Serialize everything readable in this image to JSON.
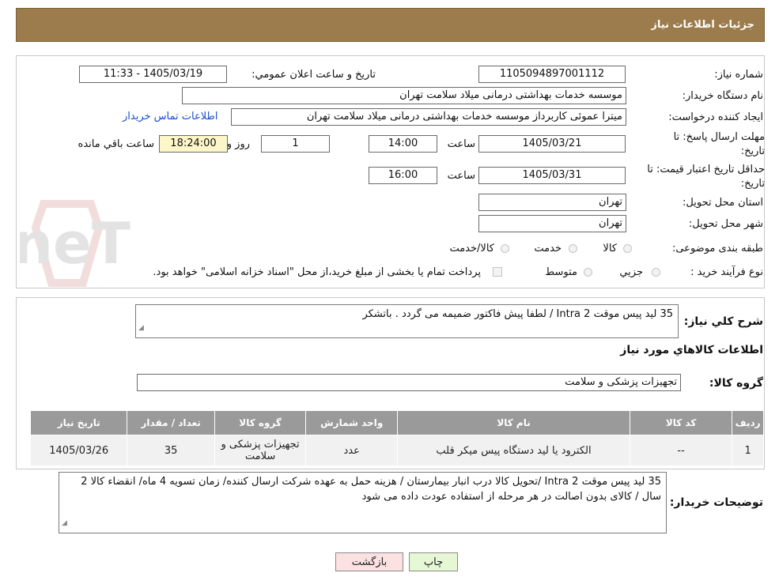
{
  "header": {
    "title": "جزئیات اطلاعات نیاز"
  },
  "watermark": {
    "text": "AriaTender.neT"
  },
  "form": {
    "need_number_label": "شماره نیاز:",
    "need_number": "1105094897001112",
    "announce_label": "تاریخ و ساعت اعلان عمومي:",
    "announce_value": "1405/03/19 - 11:33",
    "buyer_org_label": "نام دستگاه خريدار:",
    "buyer_org": "موسسه خدمات بهداشتی درمانی میلاد سلامت تهران",
    "creator_label": "ايجاد کننده درخواست:",
    "creator": "میترا عموئی کاربرداز موسسه خدمات بهداشتی درمانی میلاد سلامت تهران",
    "contact_link": "اطلاعات تماس خريدار",
    "deadline_label": "مهلت ارسال پاسخ: تا تاریخ:",
    "deadline_date": "1405/03/21",
    "time_label": "ساعت",
    "deadline_time": "14:00",
    "days_value": "1",
    "days_label": "روز و",
    "remaining_time": "18:24:00",
    "remaining_label": "ساعت باقي مانده",
    "validity_label": "حداقل تاریخ اعتبار قیمت: تا تاریخ:",
    "validity_date": "1405/03/31",
    "validity_time_label": "ساعت",
    "validity_time": "16:00",
    "province_label": "استان محل تحويل:",
    "province": "تهران",
    "city_label": "شهر محل تحويل:",
    "city": "تهران",
    "category_label": "طبقه بندی موضوعی:",
    "category_options": [
      "کالا",
      "خدمت",
      "کالا/خدمت"
    ],
    "process_label": "نوع فرآيند خريد :",
    "process_options": [
      "جزيي",
      "متوسط"
    ],
    "payment_note": "پرداخت تمام يا بخشی از مبلغ خريد،از محل \"اسناد خزانه اسلامی\" خواهد بود."
  },
  "details": {
    "desc_label": "شرح کلي نياز:",
    "desc_value": "35 لید پیس موقت Intra 2 / لطفا پیش فاکتور ضمیمه می گردد . باتشکر",
    "goods_title": "اطلاعات کالاهاي مورد نياز",
    "group_label": "گروه کالا:",
    "group_value": "تجهیزات پزشکی و سلامت",
    "table": {
      "headers": [
        "رديف",
        "کد کالا",
        "نام کالا",
        "واحد شمارش",
        "گروه کالا",
        "تعداد / مقدار",
        "تاريخ نياز"
      ],
      "rows": [
        [
          "1",
          "--",
          "الکترود یا لید دستگاه پیس میکر قلب",
          "عدد",
          "تجهيزات پزشکی و سلامت",
          "35",
          "1405/03/26"
        ]
      ]
    },
    "buyer_notes_label": "توضيحات خريدار:",
    "buyer_notes": "35 لید پیس موقت Intra 2  /تحویل کالا درب انبار بیمارستان / هزینه حمل به عهده شرکت ارسال کننده/ زمان تسویه 4 ماه/ انقضاء کالا 2 سال / کالای بدون اصالت در هر مرحله از استفاده عودت داده می شود"
  },
  "buttons": {
    "print": "چاپ",
    "back": "بازگشت"
  },
  "colors": {
    "header_bg": "#9c7c4c",
    "table_header_bg": "#9a9a9a",
    "print_btn": "#e6f7d6",
    "back_btn": "#fbe1e1",
    "remaining_bg": "#fdf6c8"
  }
}
